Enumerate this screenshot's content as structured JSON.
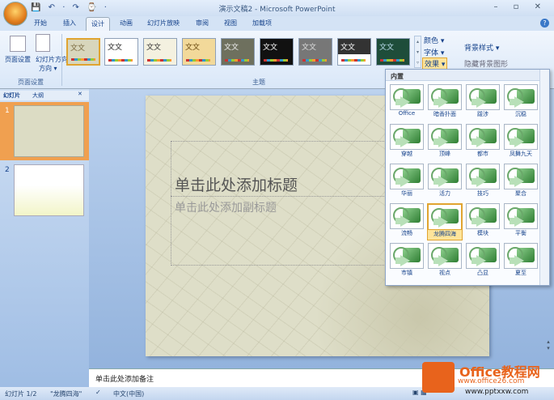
{
  "window": {
    "title": "演示文稿2 - Microsoft PowerPoint",
    "qat": "💾 ↶ · ↷ ⌚ ·",
    "controls": "– ▫ ✕",
    "help": "?"
  },
  "tabs": [
    "开始",
    "插入",
    "设计",
    "动画",
    "幻灯片放映",
    "审阅",
    "视图",
    "加载项"
  ],
  "ribbon": {
    "page_setup": "页面设置",
    "orientation": "幻灯片方向",
    "orientation2": "方向 ▾",
    "group_page_setup": "页面设置",
    "group_themes": "主题",
    "colors": "颜色 ▾",
    "fonts": "字体 ▾",
    "effects": "效果 ▾",
    "bg_styles": "背景样式 ▾",
    "hide_bg": "隐藏背景图形",
    "theme_label": "文文"
  },
  "panel": {
    "tab_slides": "幻灯片",
    "tab_outline": "大纲",
    "close": "✕",
    "slide_nums": [
      "1",
      "2"
    ]
  },
  "slide": {
    "title": "单击此处添加标题",
    "subtitle": "单击此处添加副标题"
  },
  "notes": "单击此处添加备注",
  "status": {
    "slide": "幻灯片 1/2",
    "theme": "\"龙腾四海\"",
    "lang": "中文(中国)"
  },
  "watermark": {
    "brand": "Office教程网",
    "url1": "www.office26.com",
    "url2": "www.pptxxw.com"
  },
  "gallery": {
    "header": "内置",
    "selected": "龙腾四海",
    "items": [
      "Office",
      "暗香扑面",
      "跋涉",
      "沉稳",
      "穿越",
      "顶峰",
      "都市",
      "凤舞九天",
      "华丽",
      "活力",
      "技巧",
      "聚合",
      "流畅",
      "龙腾四海",
      "模块",
      "平衡",
      "市镇",
      "视点",
      "凸显",
      "夏至"
    ]
  },
  "colors": {
    "accent": "#e0a430",
    "ribbon": "#d9e7f8",
    "green": "#2e7d32"
  }
}
